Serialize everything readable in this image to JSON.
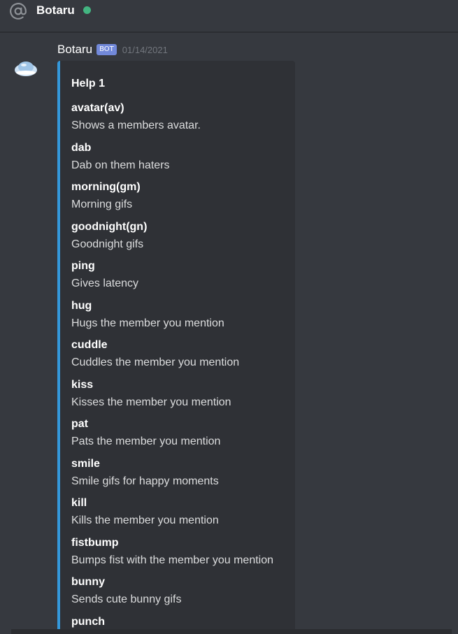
{
  "header": {
    "channel_name": "Botaru",
    "status": "online",
    "status_color": "#43b581",
    "icon": "at-icon"
  },
  "message": {
    "author": "Botaru",
    "badge": "BOT",
    "timestamp": "01/14/2021",
    "avatar_icon": "bot-avatar",
    "embed": {
      "accent_color": "#3498db",
      "title": "Help 1",
      "fields": [
        {
          "name": "avatar(av)",
          "value": "Shows a members avatar."
        },
        {
          "name": "dab",
          "value": "Dab on them haters"
        },
        {
          "name": "morning(gm)",
          "value": "Morning gifs"
        },
        {
          "name": "goodnight(gn)",
          "value": "Goodnight gifs"
        },
        {
          "name": "ping",
          "value": "Gives latency"
        },
        {
          "name": "hug",
          "value": "Hugs the member you mention"
        },
        {
          "name": "cuddle",
          "value": "Cuddles the member you mention"
        },
        {
          "name": "kiss",
          "value": "Kisses the member you mention"
        },
        {
          "name": "pat",
          "value": "Pats the member you mention"
        },
        {
          "name": "smile",
          "value": "Smile gifs for happy moments"
        },
        {
          "name": "kill",
          "value": "Kills the member you mention"
        },
        {
          "name": "fistbump",
          "value": "Bumps fist with the member you mention"
        },
        {
          "name": "bunny",
          "value": "Sends cute bunny gifs"
        },
        {
          "name": "punch",
          "value": ""
        }
      ]
    }
  }
}
